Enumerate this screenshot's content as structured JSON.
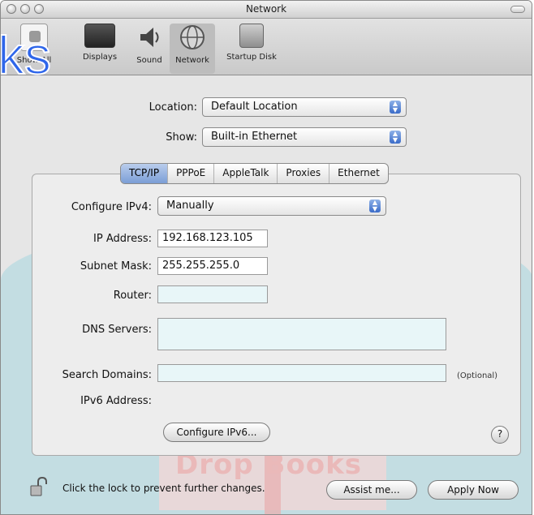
{
  "window": {
    "title": "Network"
  },
  "toolbar": {
    "show_all_label": "Show All",
    "items": [
      {
        "label": "Displays"
      },
      {
        "label": "Sound"
      },
      {
        "label": "Network"
      },
      {
        "label": "Startup Disk"
      }
    ]
  },
  "overlay_text": "ks",
  "location": {
    "label": "Location:",
    "value": "Default Location"
  },
  "show": {
    "label": "Show:",
    "value": "Built-in Ethernet"
  },
  "tabs": [
    "TCP/IP",
    "PPPoE",
    "AppleTalk",
    "Proxies",
    "Ethernet"
  ],
  "tcpip": {
    "configure_ipv4": {
      "label": "Configure IPv4:",
      "value": "Manually"
    },
    "ip_address": {
      "label": "IP Address:",
      "value": "192.168.123.105"
    },
    "subnet_mask": {
      "label": "Subnet Mask:",
      "value": "255.255.255.0"
    },
    "router": {
      "label": "Router:",
      "value": ""
    },
    "dns_servers": {
      "label": "DNS Servers:",
      "value": ""
    },
    "search_domains": {
      "label": "Search Domains:",
      "value": "",
      "hint": "(Optional)"
    },
    "ipv6_address": {
      "label": "IPv6 Address:"
    },
    "configure_ipv6_button": "Configure IPv6...",
    "help_glyph": "?"
  },
  "footer": {
    "lock_text": "Click the lock to prevent further changes.",
    "assist_button": "Assist me...",
    "apply_button": "Apply Now"
  },
  "watermark": {
    "text": "Drop Books"
  },
  "colors": {
    "accent": "#3a6bc8",
    "overlay": "#2f66ea",
    "watermark": "#c3dde2"
  }
}
